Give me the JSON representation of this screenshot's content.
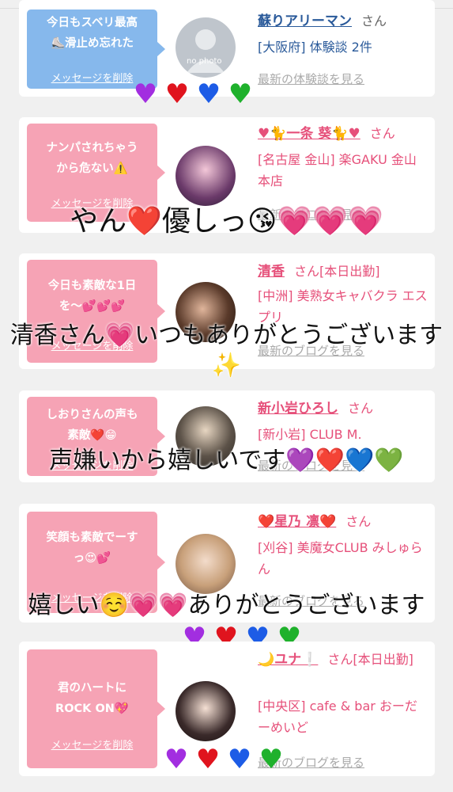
{
  "cards": [
    {
      "message": "今日もスベリ最高\n⛸️滑止め忘れた",
      "delete_label": "メッセージを削除",
      "name": "蘇りアリーマン",
      "san": "さん",
      "info": "[大阪府] 体験談 2件",
      "link": "最新の体験談を見る",
      "avatar_placeholder": "no photo"
    },
    {
      "message": "ナンパされちゃう\nから危ない⚠️",
      "delete_label": "メッセージを削除",
      "name": "♥🐈一条 葵🐈♥",
      "san": "さん",
      "info": "[名古屋 金山] 楽GAKU 金山本店",
      "link": "最新のブログを見る"
    },
    {
      "message": "今日も素敵な1日\nを〜💕💕💕",
      "delete_label": "メッセージを削除",
      "name": "清香",
      "san": "さん[本日出勤]",
      "info": "[中洲] 美熟女キャバクラ エスプリ",
      "link": "最新のブログを見る"
    },
    {
      "message": "しおりさんの声も\n素敵❤️😁",
      "delete_label": "メッセージを削除",
      "name": "新小岩ひろし",
      "san": "さん",
      "info": "[新小岩] CLUB M.",
      "link": "最新のブログを見る"
    },
    {
      "message": "笑顔も素敵でーす\nっ😍💕",
      "delete_label": "メッセージを削除",
      "name": "❤️星乃 凛❤️",
      "san": "さん",
      "info": "[刈谷] 美魔女CLUB みしゅらん",
      "link": "最新のブログを見る"
    },
    {
      "message": "君のハートに\nROCK ON💖",
      "delete_label": "メッセージを削除",
      "name": "🌙ユナ❕",
      "san": "さん[本日出勤]",
      "info": "[中央区] cafe & bar おーだーめいど",
      "link": "最新のブログを見る"
    }
  ],
  "overlays": {
    "line1": "やん❤️優しっ😘💗💗💗",
    "line2": "清香さん💗いつもありがとうございます✨",
    "line3": "声嫌いから嬉しいです💜❤️💙💚",
    "line4": "嬉しい☺️💗💗ありがとうございます"
  },
  "heart_glyph": "♥",
  "colors": {
    "bubble_pink": "#f6a3b5",
    "bubble_blue": "#86b8ec",
    "name_pink": "#e6507a",
    "name_blue": "#2a5a9a",
    "link_gray": "#aaaaaa"
  }
}
